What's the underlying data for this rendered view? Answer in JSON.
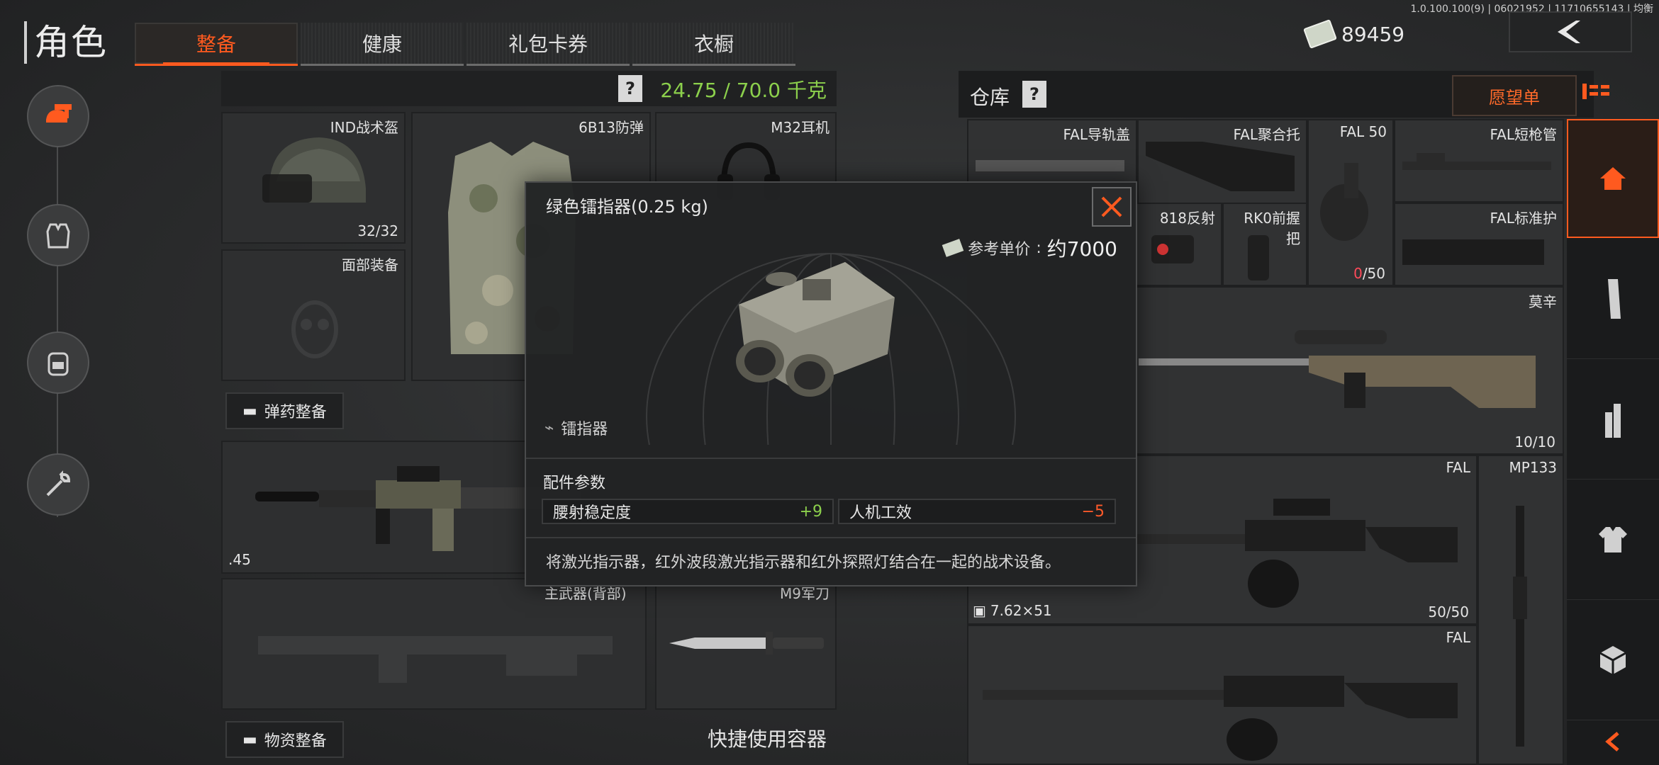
{
  "version": "1.0.100.100(9) | 06021952 | 11710655143 | 均衡",
  "title": "角色",
  "tabs": [
    "整备",
    "健康",
    "礼包卡券",
    "衣橱"
  ],
  "currency": {
    "amount": "89459"
  },
  "equipment": {
    "weight": "24.75 / 70.0 千克",
    "help": "?",
    "helmet": {
      "label": "IND战术盔",
      "count": "32/32"
    },
    "armor": {
      "label": "6B13防弹"
    },
    "headset": {
      "label": "M32耳机"
    },
    "face": {
      "label": "面部装备"
    },
    "ammo_btn": "弹药整备",
    "primary": {
      "caliber": ".45"
    },
    "back_weapon": {
      "label": "主武器(背部)"
    },
    "knife": {
      "label": "M9军刀"
    },
    "supply_btn": "物资整备",
    "quick_container": "快捷使用容器"
  },
  "warehouse": {
    "title": "仓库",
    "help": "?",
    "wishlist": "愿望单",
    "items": {
      "fal_rail": "FAL导轨盖",
      "fal_stock": "FAL聚合托",
      "fal_50": "FAL 50",
      "fal_50_count_red": "0",
      "fal_50_count_rest": "/50",
      "fal_short": "FAL短枪管",
      "reflex": "818反射",
      "rk0": "RK0前握\n把",
      "fal_guard": "FAL标准护",
      "mosin": "莫辛",
      "mosin_count": "10/10",
      "fal_a": "FAL",
      "fal_a_ammo": "7.62×51",
      "fal_a_count": "50/50",
      "mp133": "MP133",
      "fal_b": "FAL"
    }
  },
  "modal": {
    "title": "绿色镭指器(0.25 kg)",
    "price_label": "参考单价",
    "price_value": "约7000",
    "category": "镭指器",
    "params_title": "配件参数",
    "params": [
      {
        "name": "腰射稳定度",
        "value": "+9",
        "color": "#8cd04c"
      },
      {
        "name": "人机工效",
        "value": "−5",
        "color": "#ff5a2a"
      }
    ],
    "description": "将激光指示器，红外波段激光指示器和红外探照灯结合在一起的战术设备。"
  },
  "colors": {
    "accent": "#ff5a1f",
    "good": "#8cd04c",
    "bad": "#ff5a2a"
  }
}
